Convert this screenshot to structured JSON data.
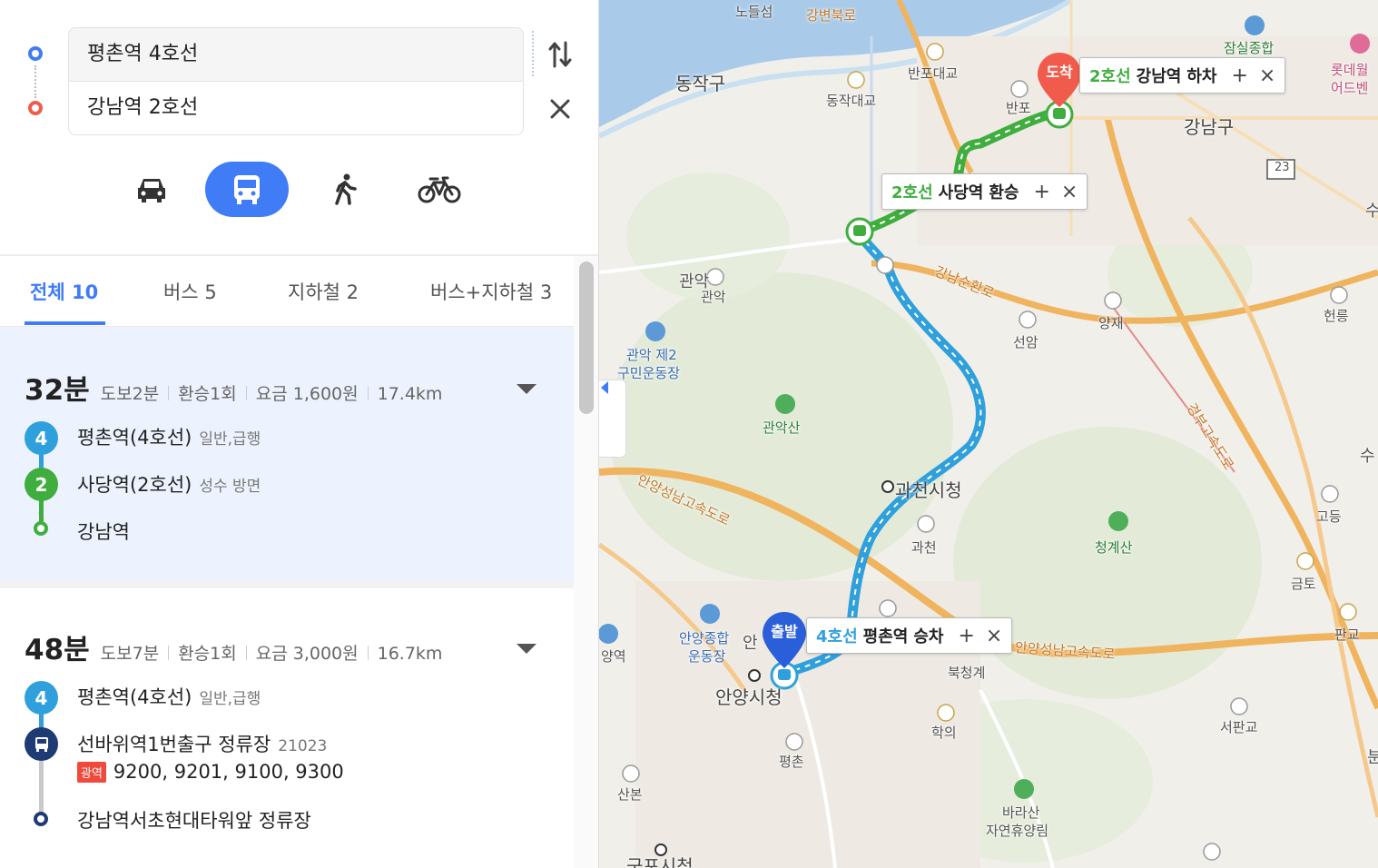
{
  "search": {
    "origin": "평촌역 4호선",
    "destination": "강남역 2호선"
  },
  "tabs": [
    {
      "label": "전체 10",
      "active": true
    },
    {
      "label": "버스 5",
      "active": false
    },
    {
      "label": "지하철 2",
      "active": false
    },
    {
      "label": "버스+지하철 3",
      "active": false
    }
  ],
  "routes": [
    {
      "time": "32분",
      "walk": "도보2분",
      "transfer": "환승1회",
      "fare": "요금 1,600원",
      "distance": "17.4km",
      "steps": [
        {
          "badge": "4",
          "name": "평촌역(4호선)",
          "sub": "일반,급행"
        },
        {
          "badge": "2",
          "name": "사당역(2호선)",
          "sub": "성수 방면"
        },
        {
          "name": "강남역"
        }
      ]
    },
    {
      "time": "48분",
      "walk": "도보7분",
      "transfer": "환승1회",
      "fare": "요금 3,000원",
      "distance": "16.7km",
      "steps": [
        {
          "badge": "4",
          "name": "평촌역(4호선)",
          "sub": "일반,급행"
        },
        {
          "name": "선바위역1번출구 정류장",
          "sub": "21023",
          "bus_type": "광역",
          "buses": "9200, 9201, 9100, 9300"
        },
        {
          "name": "강남역서초현대타워앞 정류장"
        }
      ]
    }
  ],
  "map": {
    "arrive_pin": "도착",
    "depart_pin": "출발",
    "callouts": {
      "arrive": {
        "line": "2호선",
        "station": "강남역",
        "action": "하차"
      },
      "transfer": {
        "line": "2호선",
        "station": "사당역",
        "action": "환승"
      },
      "depart": {
        "line": "4호선",
        "station": "평촌역",
        "action": "승차"
      },
      "add_symbol": "+",
      "close_symbol": "×"
    },
    "labels": {
      "nodeulseom": "노들섬",
      "gangbyeon": "강변북로",
      "dongjak_gu": "동작구",
      "banpo_bridge": "반포대교",
      "dongjak_bridge": "동작대교",
      "banpo": "반포",
      "jamsil": "잠실종합",
      "lotte1": "롯데월",
      "lotte2": "어드벤",
      "gangnam_gu": "강남구",
      "road23": "23",
      "gwanak_ic": "관악",
      "gwanak_c": "관악",
      "gwanak_field1": "관악 제2",
      "gwanak_field2": "구민운동장",
      "gwanaksan": "관악산",
      "gangnam_ring": "강남순환로",
      "yangjae": "양재",
      "seonam": "선암",
      "heolleung": "헌릉",
      "gyeongbu": "경부고속도로",
      "anyang_seongnam": "안양성남고속도로",
      "gwacheon_city": "과천시청",
      "gwacheon_ic": "과천",
      "cheonggyesan": "청계산",
      "godeung": "고등",
      "geumto": "금토",
      "pangyo": "판교",
      "anyang_sports1": "안양종합",
      "anyang_sports2": "운동장",
      "anyang_short": "안",
      "bukcheonggye": "북청계",
      "anyang_city": "안양시청",
      "hagui": "학의",
      "pyeongchon": "평촌",
      "sanbon": "산본",
      "barasan1": "바라산",
      "barasan2": "자연휴양림",
      "seopangyo": "서판교",
      "anyang_yeok": "양역",
      "gunpo": "군포시청",
      "su": "수",
      "su2": "수",
      "bun": "분",
      "anyang_seongnam2": "안양성남고속도로"
    }
  },
  "colors": {
    "accent": "#3f7cf6",
    "line4": "#2fa0db",
    "line2": "#3fae3f",
    "arrive_pin": "#f05b4c",
    "depart_pin": "#2b5fd9",
    "bus_dark": "#1f3b73"
  },
  "icons": [
    "origin-dot-icon",
    "destination-dot-icon",
    "swap-icon",
    "close-icon",
    "car-icon",
    "bus-icon",
    "walk-icon",
    "bicycle-icon",
    "chevron-down-icon",
    "chevron-left-icon"
  ]
}
